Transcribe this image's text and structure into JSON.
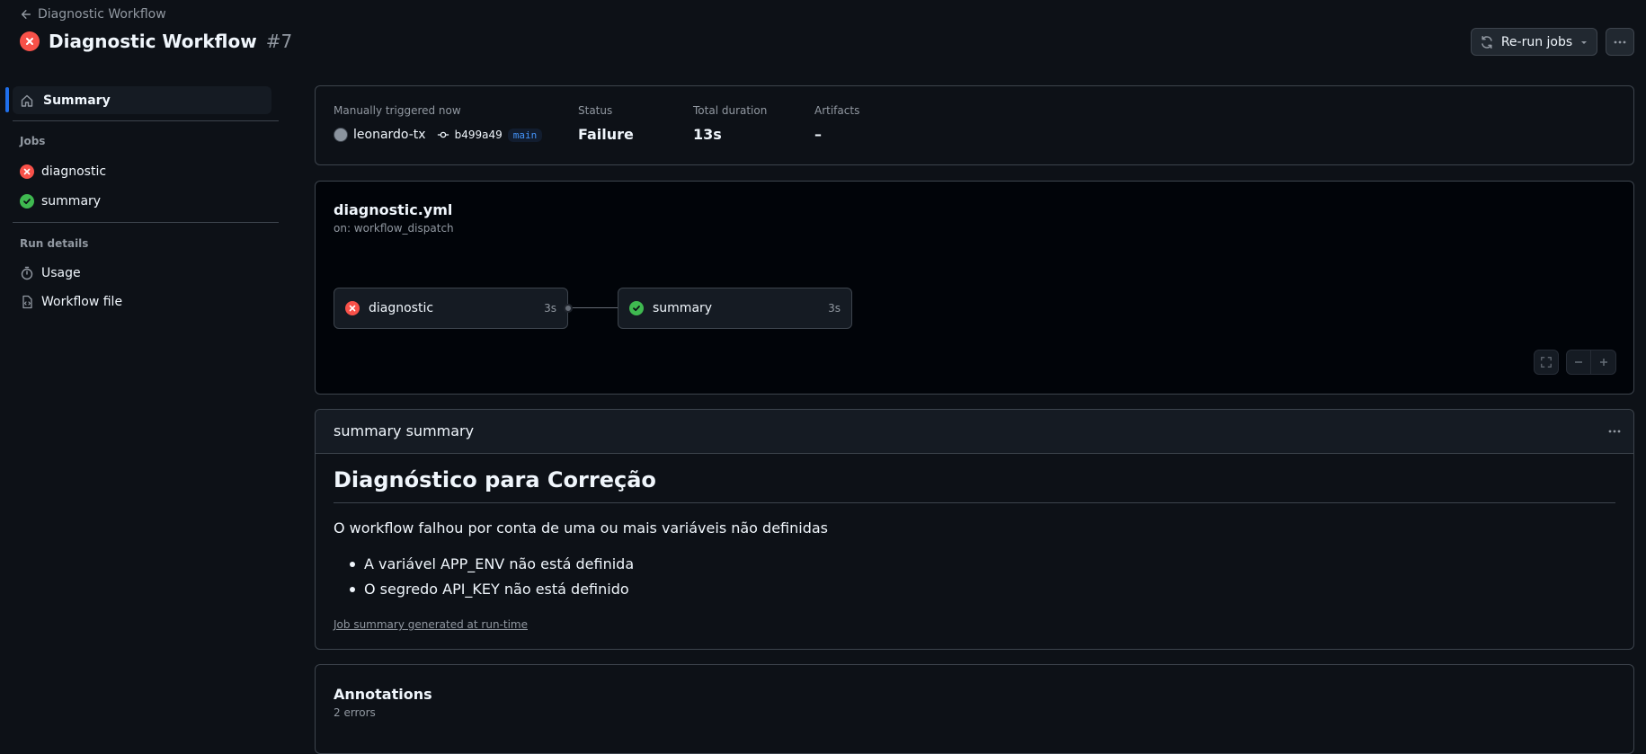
{
  "header": {
    "back_label": "Diagnostic Workflow",
    "title": "Diagnostic Workflow",
    "run_number": "#7",
    "rerun_label": "Re-run jobs"
  },
  "sidebar": {
    "summary_label": "Summary",
    "jobs_heading": "Jobs",
    "jobs": [
      {
        "label": "diagnostic",
        "status": "failure"
      },
      {
        "label": "summary",
        "status": "success"
      }
    ],
    "run_details_heading": "Run details",
    "usage_label": "Usage",
    "workflow_file_label": "Workflow file"
  },
  "run_summary": {
    "trigger_label": "Manually triggered now",
    "actor": "leonardo-tx",
    "commit": "b499a49",
    "branch": "main",
    "status_label": "Status",
    "status_value": "Failure",
    "duration_label": "Total duration",
    "duration_value": "13s",
    "artifacts_label": "Artifacts",
    "artifacts_value": "–"
  },
  "graph": {
    "file_name": "diagnostic.yml",
    "trigger": "on: workflow_dispatch",
    "nodes": [
      {
        "label": "diagnostic",
        "duration": "3s",
        "status": "failure"
      },
      {
        "label": "summary",
        "duration": "3s",
        "status": "success"
      }
    ]
  },
  "job_summary": {
    "header": "summary summary",
    "heading": "Diagnóstico para Correção",
    "paragraph": "O workflow falhou por conta de uma ou mais variáveis não definidas",
    "items": [
      "A variável APP_ENV não está definida",
      "O segredo API_KEY não está definido"
    ],
    "footnote": "Job summary generated at run-time"
  },
  "annotations": {
    "title": "Annotations",
    "count": "2 errors"
  },
  "colors": {
    "background": "#0d1117",
    "failure": "#f85149",
    "success": "#3fb950",
    "accent": "#1f6feb",
    "border": "#3d444d"
  }
}
